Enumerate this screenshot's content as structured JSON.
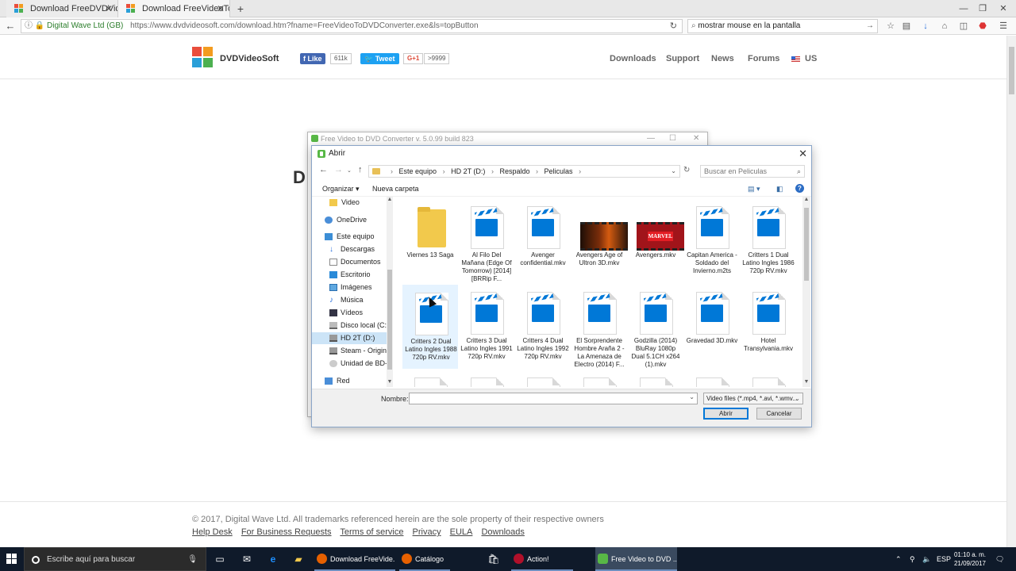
{
  "browser": {
    "tabs": [
      {
        "title": "Download FreeDVDVideoCo"
      },
      {
        "title": "Download FreeVideoToDVD"
      }
    ],
    "url_security": "Digital Wave Ltd (GB)",
    "url": "https://www.dvdvideosoft.com/download.htm?fname=FreeVideoToDVDConverter.exe&ls=topButton",
    "search_text": "mostrar mouse en la pantalla"
  },
  "site": {
    "brand": "DVDVideoSoft",
    "fb_like": "Like",
    "fb_count": "611k",
    "tweet": "Tweet",
    "gplus": "G+1",
    "gplus_count": ">9999",
    "nav": [
      "Downloads",
      "Support",
      "News",
      "Forums",
      "US"
    ],
    "partial_heading": "D",
    "footer_copyright": "© 2017, Digital Wave Ltd.   All trademarks referenced herein are the sole property of their respective owners",
    "footer_links": [
      "Help Desk",
      "For Business Requests",
      "Terms of service",
      "Privacy",
      "EULA",
      "Downloads"
    ]
  },
  "app_window": {
    "title": "Free Video to DVD Converter  v. 5.0.99 build 823"
  },
  "dialog": {
    "title": "Abrir",
    "breadcrumb": [
      "Este equipo",
      "HD 2T (D:)",
      "Respaldo",
      "Peliculas"
    ],
    "search_placeholder": "Buscar en Peliculas",
    "organize": "Organizar",
    "new_folder": "Nueva carpeta",
    "nav_items": [
      {
        "label": "Video"
      },
      {
        "label": "OneDrive"
      },
      {
        "label": "Este equipo"
      },
      {
        "label": "Descargas"
      },
      {
        "label": "Documentos"
      },
      {
        "label": "Escritorio"
      },
      {
        "label": "Imágenes"
      },
      {
        "label": "Música"
      },
      {
        "label": "Vídeos"
      },
      {
        "label": "Disco local (C:)"
      },
      {
        "label": "HD 2T (D:)"
      },
      {
        "label": "Steam - Origin (I"
      },
      {
        "label": "Unidad de BD-RI"
      },
      {
        "label": "Red"
      }
    ],
    "files": [
      {
        "name": "Viernes 13 Saga",
        "kind": "folder"
      },
      {
        "name": "Al Filo Del Mañana (Edge Of Tomorrow) [2014] [BRRip F...",
        "kind": "video"
      },
      {
        "name": "Avenger confidential.mkv",
        "kind": "video"
      },
      {
        "name": "Avengers Age of Ultron 3D.mkv",
        "kind": "thumb-avengers"
      },
      {
        "name": "Avengers.mkv",
        "kind": "thumb-marvel"
      },
      {
        "name": "Capitan America - Soldado del Invierno.m2ts",
        "kind": "video"
      },
      {
        "name": "Critters 1 Dual Latino Ingles 1986 720p RV.mkv",
        "kind": "video"
      },
      {
        "name": "Critters 2 Dual Latino Ingles 1988 720p RV.mkv",
        "kind": "video"
      },
      {
        "name": "Critters 3 Dual Latino Ingles 1991 720p RV.mkv",
        "kind": "video"
      },
      {
        "name": "Critters 4 Dual Latino Ingles 1992 720p RV.mkv",
        "kind": "video"
      },
      {
        "name": "El Sorprendente Hombre Araña 2 - La Amenaza de Electro (2014) F...",
        "kind": "video"
      },
      {
        "name": "Godzilla (2014) BluRay 1080p Dual 5.1CH x264 (1).mkv",
        "kind": "video"
      },
      {
        "name": "Gravedad 3D.mkv",
        "kind": "video"
      },
      {
        "name": "Hotel Transylvania.mkv",
        "kind": "video"
      }
    ],
    "marvel_text": "MARVEL",
    "name_label": "Nombre:",
    "name_value": "",
    "file_type": "Video files (*.mp4, *.avi, *.wmv...",
    "open_btn": "Abrir",
    "cancel_btn": "Cancelar"
  },
  "taskbar": {
    "search_placeholder": "Escribe aquí para buscar",
    "apps": [
      {
        "label": "Download FreeVide..."
      },
      {
        "label": "Catálogo"
      },
      {
        "label": "Action!"
      },
      {
        "label": "Free Video to DVD ..."
      }
    ],
    "lang": "ESP",
    "time": "01:10 a. m.",
    "date": "21/09/2017"
  },
  "colors": {
    "accent_blue": "#0078d7",
    "folder_yellow": "#f2c94c",
    "brand_green": "#58b846"
  }
}
